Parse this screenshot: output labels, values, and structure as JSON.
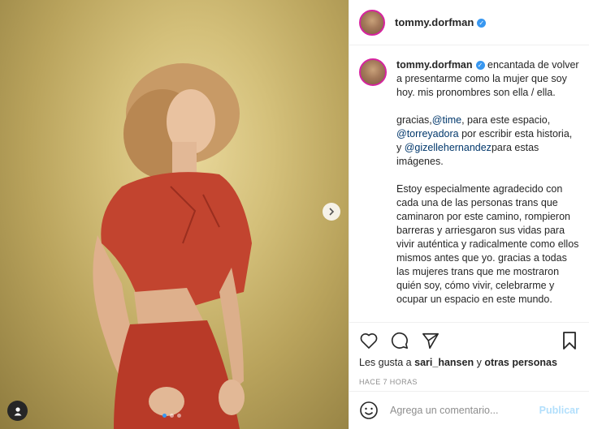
{
  "header": {
    "username": "tommy.dorfman"
  },
  "caption": {
    "username": "tommy.dorfman",
    "line1": "encantada de volver a presentarme como la mujer que soy hoy. mis pronombres son ella / ella.",
    "p2_pre": "gracias,",
    "p2_m1": "@time",
    "p2_mid1": ", para este espacio, ",
    "p2_m2": "@torreyadora",
    "p2_mid2": " por escribir esta historia, y ",
    "p2_m3": "@gizellehernandez",
    "p2_post": "para estas imágenes.",
    "p3": "Estoy especialmente agradecido con cada una de las personas trans que caminaron por este camino, rompieron barreras y arriesgaron sus vidas para vivir auténtica y radicalmente como ellos mismos antes que yo. gracias a todas las mujeres trans que me mostraron quién soy, cómo vivir, celebrarme y ocupar un espacio en este mundo."
  },
  "likes": {
    "prefix": "Les gusta a",
    "user": "sari_hansen",
    "connector": "y",
    "others": "otras personas"
  },
  "timestamp": "HACE 7 HORAS",
  "comment_box": {
    "placeholder": "Agrega un comentario...",
    "publish": "Publicar"
  },
  "carousel": {
    "total": 3,
    "current": 1
  },
  "colors": {
    "accent": "#3897f0",
    "publish_disabled": "#b2dffc",
    "mention": "#00376b"
  }
}
